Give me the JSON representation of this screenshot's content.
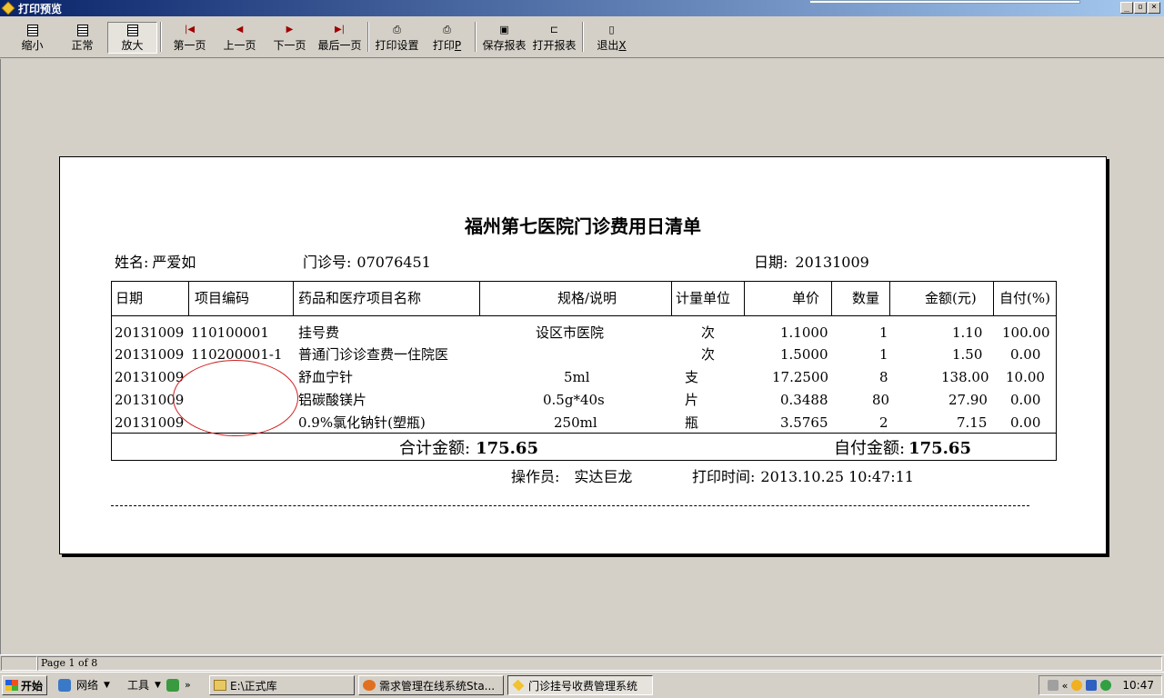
{
  "window": {
    "title": "打印预览"
  },
  "toolbar": {
    "buttons": [
      {
        "label": "缩小",
        "icon": "page-icon"
      },
      {
        "label": "正常",
        "icon": "page-icon"
      },
      {
        "label": "放大",
        "icon": "page-icon",
        "pressed": true
      },
      {
        "label": "第一页",
        "icon": "first-page-icon"
      },
      {
        "label": "上一页",
        "icon": "prev-page-icon"
      },
      {
        "label": "下一页",
        "icon": "next-page-icon"
      },
      {
        "label": "最后一页",
        "icon": "last-page-icon"
      },
      {
        "label": "打印设置",
        "icon": "printer-setup-icon"
      },
      {
        "label": "打印",
        "shortcut": "P",
        "icon": "printer-icon"
      },
      {
        "label": "保存报表",
        "icon": "floppy-icon"
      },
      {
        "label": "打开报表",
        "icon": "open-folder-icon"
      },
      {
        "label": "退出",
        "shortcut": "X",
        "icon": "exit-door-icon"
      }
    ]
  },
  "report": {
    "title": "福州第七医院门诊费用日清单",
    "name_label": "姓名:",
    "name": "严爱如",
    "clinic_no_label": "门诊号:",
    "clinic_no": "07076451",
    "date_label": "日期:",
    "date": "20131009",
    "columns": [
      "日期",
      "项目编码",
      "药品和医疗项目名称",
      "规格/说明",
      "计量单位",
      "单价",
      "数量",
      "金额(元)",
      "自付(%)"
    ],
    "rows": [
      {
        "date": "20131009",
        "code": "110100001",
        "name": "挂号费",
        "spec": "设区市医院",
        "unit": "次",
        "price": "1.1000",
        "qty": "1",
        "amount": "1.10",
        "self": "100.00"
      },
      {
        "date": "20131009",
        "code": "110200001-1",
        "name": "普通门诊诊查费一住院医",
        "spec": "",
        "unit": "次",
        "price": "1.5000",
        "qty": "1",
        "amount": "1.50",
        "self": "0.00"
      },
      {
        "date": "20131009",
        "code": "",
        "name": "舒血宁针",
        "spec": "5ml",
        "unit": "支",
        "price": "17.2500",
        "qty": "8",
        "amount": "138.00",
        "self": "10.00"
      },
      {
        "date": "20131009",
        "code": "",
        "name": "铝碳酸镁片",
        "spec": "0.5g*40s",
        "unit": "片",
        "price": "0.3488",
        "qty": "80",
        "amount": "27.90",
        "self": "0.00"
      },
      {
        "date": "20131009",
        "code": "",
        "name": "0.9%氯化钠针(塑瓶)",
        "spec": "250ml",
        "unit": "瓶",
        "price": "3.5765",
        "qty": "2",
        "amount": "7.15",
        "self": "0.00"
      }
    ],
    "total_label": "合计金额:",
    "total": "175.65",
    "self_total_label": "自付金额:",
    "self_total": "175.65",
    "operator_label": "操作员:",
    "operator": "实达巨龙",
    "print_time_label": "打印时间:",
    "print_time": "2013.10.25 10:47:11"
  },
  "statusbar": {
    "page": "Page 1 of 8"
  },
  "taskbar": {
    "start": "开始",
    "quicklaunch": [
      {
        "label": "网络",
        "icon": "network-icon"
      },
      {
        "label": "工具",
        "icon": "tools-icon"
      }
    ],
    "tasks": [
      {
        "label": "E:\\正式库",
        "icon": "folder-icon"
      },
      {
        "label": "需求管理在线系统Sta...",
        "icon": "browser-icon"
      },
      {
        "label": "门诊挂号收费管理系统",
        "icon": "app-icon"
      }
    ],
    "clock": "10:47"
  }
}
